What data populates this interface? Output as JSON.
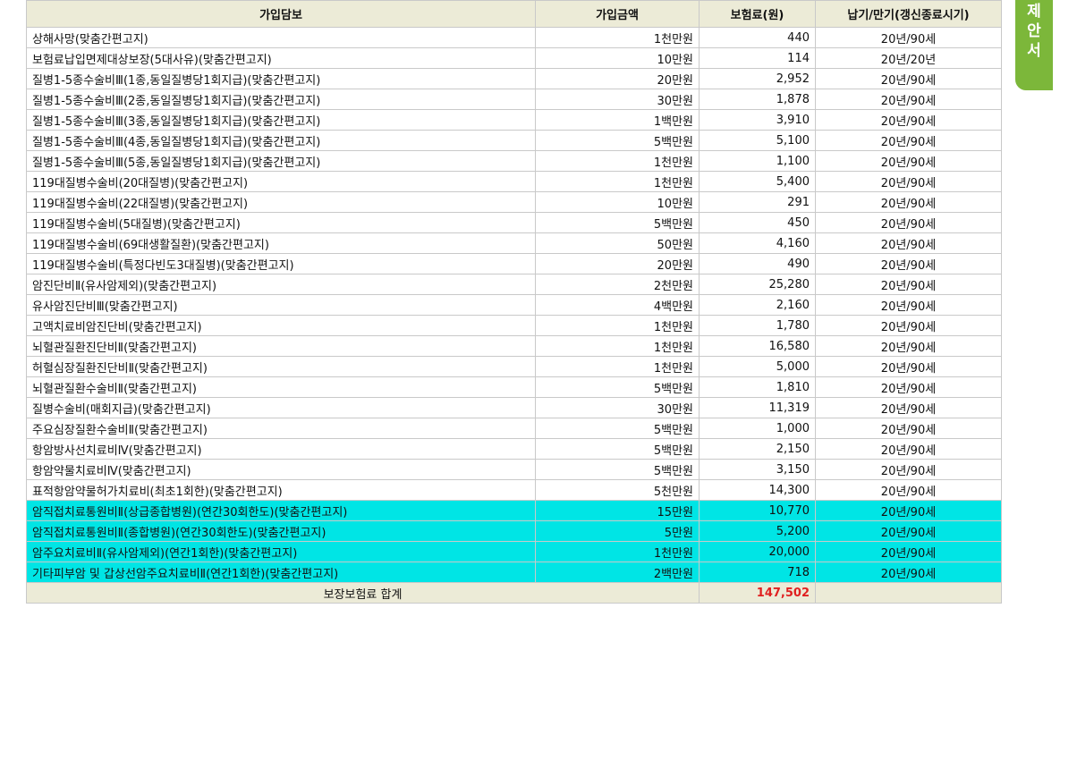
{
  "table": {
    "headers": [
      "가입담보",
      "가입금액",
      "보험료(원)",
      "납기/만기(갱신종료시기)"
    ],
    "rows": [
      {
        "name": "상해사망(맞춤간편고지)",
        "amount": "1천만원",
        "premium": "440",
        "term": "20년/90세",
        "highlight": false
      },
      {
        "name": "보험료납입면제대상보장(5대사유)(맞춤간편고지)",
        "amount": "10만원",
        "premium": "114",
        "term": "20년/20년",
        "highlight": false
      },
      {
        "name": "질병1-5종수술비Ⅲ(1종,동일질병당1회지급)(맞춤간편고지)",
        "amount": "20만원",
        "premium": "2,952",
        "term": "20년/90세",
        "highlight": false
      },
      {
        "name": "질병1-5종수술비Ⅲ(2종,동일질병당1회지급)(맞춤간편고지)",
        "amount": "30만원",
        "premium": "1,878",
        "term": "20년/90세",
        "highlight": false
      },
      {
        "name": "질병1-5종수술비Ⅲ(3종,동일질병당1회지급)(맞춤간편고지)",
        "amount": "1백만원",
        "premium": "3,910",
        "term": "20년/90세",
        "highlight": false
      },
      {
        "name": "질병1-5종수술비Ⅲ(4종,동일질병당1회지급)(맞춤간편고지)",
        "amount": "5백만원",
        "premium": "5,100",
        "term": "20년/90세",
        "highlight": false
      },
      {
        "name": "질병1-5종수술비Ⅲ(5종,동일질병당1회지급)(맞춤간편고지)",
        "amount": "1천만원",
        "premium": "1,100",
        "term": "20년/90세",
        "highlight": false
      },
      {
        "name": "119대질병수술비(20대질병)(맞춤간편고지)",
        "amount": "1천만원",
        "premium": "5,400",
        "term": "20년/90세",
        "highlight": false
      },
      {
        "name": "119대질병수술비(22대질병)(맞춤간편고지)",
        "amount": "10만원",
        "premium": "291",
        "term": "20년/90세",
        "highlight": false
      },
      {
        "name": "119대질병수술비(5대질병)(맞춤간편고지)",
        "amount": "5백만원",
        "premium": "450",
        "term": "20년/90세",
        "highlight": false
      },
      {
        "name": "119대질병수술비(69대생활질환)(맞춤간편고지)",
        "amount": "50만원",
        "premium": "4,160",
        "term": "20년/90세",
        "highlight": false
      },
      {
        "name": "119대질병수술비(특정다빈도3대질병)(맞춤간편고지)",
        "amount": "20만원",
        "premium": "490",
        "term": "20년/90세",
        "highlight": false
      },
      {
        "name": "암진단비Ⅱ(유사암제외)(맞춤간편고지)",
        "amount": "2천만원",
        "premium": "25,280",
        "term": "20년/90세",
        "highlight": false
      },
      {
        "name": "유사암진단비Ⅲ(맞춤간편고지)",
        "amount": "4백만원",
        "premium": "2,160",
        "term": "20년/90세",
        "highlight": false
      },
      {
        "name": "고액치료비암진단비(맞춤간편고지)",
        "amount": "1천만원",
        "premium": "1,780",
        "term": "20년/90세",
        "highlight": false
      },
      {
        "name": "뇌혈관질환진단비Ⅱ(맞춤간편고지)",
        "amount": "1천만원",
        "premium": "16,580",
        "term": "20년/90세",
        "highlight": false
      },
      {
        "name": "허혈심장질환진단비Ⅱ(맞춤간편고지)",
        "amount": "1천만원",
        "premium": "5,000",
        "term": "20년/90세",
        "highlight": false
      },
      {
        "name": "뇌혈관질환수술비Ⅱ(맞춤간편고지)",
        "amount": "5백만원",
        "premium": "1,810",
        "term": "20년/90세",
        "highlight": false
      },
      {
        "name": "질병수술비(매회지급)(맞춤간편고지)",
        "amount": "30만원",
        "premium": "11,319",
        "term": "20년/90세",
        "highlight": false
      },
      {
        "name": "주요심장질환수술비Ⅱ(맞춤간편고지)",
        "amount": "5백만원",
        "premium": "1,000",
        "term": "20년/90세",
        "highlight": false
      },
      {
        "name": "항암방사선치료비Ⅳ(맞춤간편고지)",
        "amount": "5백만원",
        "premium": "2,150",
        "term": "20년/90세",
        "highlight": false
      },
      {
        "name": "항암약물치료비Ⅳ(맞춤간편고지)",
        "amount": "5백만원",
        "premium": "3,150",
        "term": "20년/90세",
        "highlight": false
      },
      {
        "name": "표적항암약물허가치료비(최초1회한)(맞춤간편고지)",
        "amount": "5천만원",
        "premium": "14,300",
        "term": "20년/90세",
        "highlight": false
      },
      {
        "name": "암직접치료통원비Ⅱ(상급종합병원)(연간30회한도)(맞춤간편고지)",
        "amount": "15만원",
        "premium": "10,770",
        "term": "20년/90세",
        "highlight": true
      },
      {
        "name": "암직접치료통원비Ⅱ(종합병원)(연간30회한도)(맞춤간편고지)",
        "amount": "5만원",
        "premium": "5,200",
        "term": "20년/90세",
        "highlight": true
      },
      {
        "name": "암주요치료비Ⅱ(유사암제외)(연간1회한)(맞춤간편고지)",
        "amount": "1천만원",
        "premium": "20,000",
        "term": "20년/90세",
        "highlight": true
      },
      {
        "name": "기타피부암 및 갑상선암주요치료비Ⅱ(연간1회한)(맞춤간편고지)",
        "amount": "2백만원",
        "premium": "718",
        "term": "20년/90세",
        "highlight": true
      }
    ],
    "total": {
      "label": "보장보험료 합계",
      "value": "147,502"
    }
  },
  "side_tab": {
    "chars": [
      "제",
      "안",
      "서"
    ]
  },
  "colors": {
    "header_bg": "#ecebd7",
    "highlight_bg": "#00e5e5",
    "total_value": "#e02020",
    "tab_green": "#7cb73a",
    "border": "#c9c9c9"
  }
}
